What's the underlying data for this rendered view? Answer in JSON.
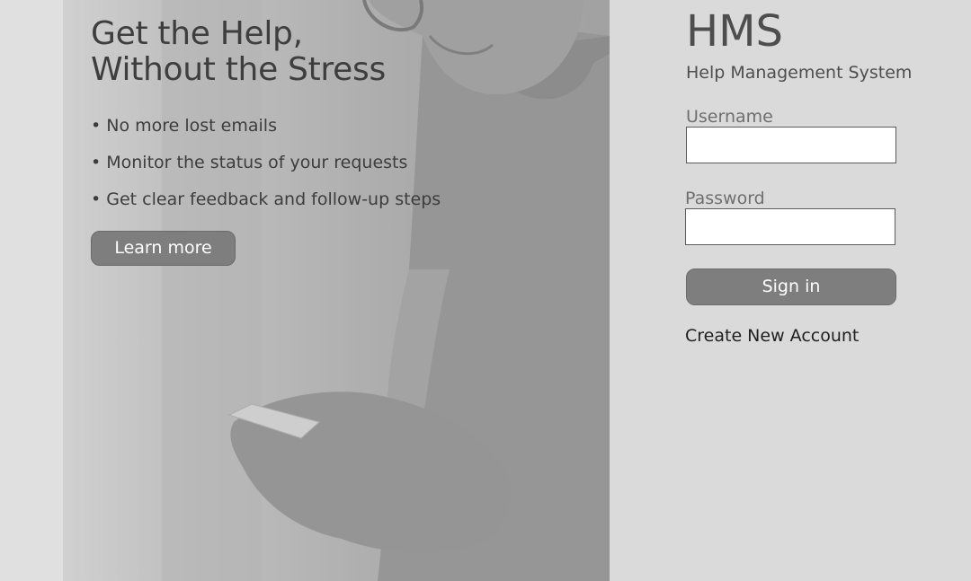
{
  "hero": {
    "headline_line1": "Get the Help,",
    "headline_line2": "Without the Stress",
    "bullets": [
      "• No more lost emails",
      "• Monitor the status of your requests",
      "• Get clear feedback and follow-up steps"
    ],
    "learn_more_label": "Learn more"
  },
  "login": {
    "logo": "HMS",
    "subtitle": "Help Management System",
    "username_label": "Username",
    "username_value": "",
    "password_label": "Password",
    "password_value": "",
    "sign_in_label": "Sign in",
    "create_account_label": "Create New Account"
  },
  "colors": {
    "panel_background": "#dadada",
    "button_fill": "#7e7e7e",
    "button_text": "#ffffff"
  }
}
